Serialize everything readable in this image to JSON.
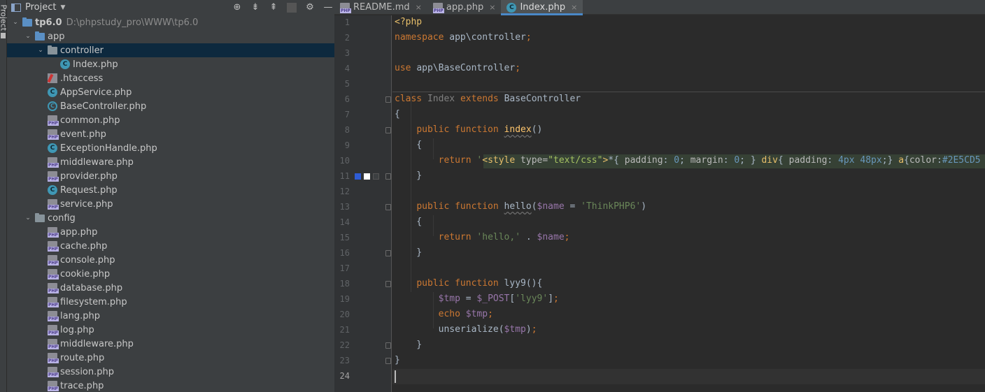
{
  "sidebar_strip": {
    "label": "Project"
  },
  "project_panel": {
    "title": "Project",
    "tools": [
      "⊕",
      "⇟",
      "⇞",
      "⚙",
      "—"
    ]
  },
  "tree": [
    {
      "label": "tp6.0",
      "path": "D:\\phpstudy_pro\\WWW\\tp6.0",
      "type": "folder-blue",
      "arrow": "⌄"
    },
    {
      "label": "app",
      "type": "folder-blue",
      "arrow": "⌄"
    },
    {
      "label": "controller",
      "type": "folder",
      "arrow": "⌄",
      "selected": true
    },
    {
      "label": "Index.php",
      "type": "cls"
    },
    {
      "label": ".htaccess",
      "type": "ht"
    },
    {
      "label": "AppService.php",
      "type": "cls"
    },
    {
      "label": "BaseController.php",
      "type": "acls"
    },
    {
      "label": "common.php",
      "type": "php"
    },
    {
      "label": "event.php",
      "type": "php"
    },
    {
      "label": "ExceptionHandle.php",
      "type": "cls"
    },
    {
      "label": "middleware.php",
      "type": "php"
    },
    {
      "label": "provider.php",
      "type": "php"
    },
    {
      "label": "Request.php",
      "type": "cls"
    },
    {
      "label": "service.php",
      "type": "php"
    },
    {
      "label": "config",
      "type": "folder",
      "arrow": "⌄"
    },
    {
      "label": "app.php",
      "type": "php"
    },
    {
      "label": "cache.php",
      "type": "php"
    },
    {
      "label": "console.php",
      "type": "php"
    },
    {
      "label": "cookie.php",
      "type": "php"
    },
    {
      "label": "database.php",
      "type": "php"
    },
    {
      "label": "filesystem.php",
      "type": "php"
    },
    {
      "label": "lang.php",
      "type": "php"
    },
    {
      "label": "log.php",
      "type": "php"
    },
    {
      "label": "middleware.php",
      "type": "php"
    },
    {
      "label": "route.php",
      "type": "php"
    },
    {
      "label": "session.php",
      "type": "php"
    },
    {
      "label": "trace.php",
      "type": "php"
    }
  ],
  "tabs": [
    {
      "label": "README.md",
      "icon": "md",
      "active": false
    },
    {
      "label": "app.php",
      "icon": "php",
      "active": false
    },
    {
      "label": "Index.php",
      "icon": "cls",
      "active": true
    }
  ],
  "editor": {
    "line_count": 24,
    "current_line": 24,
    "lines": [
      [
        [
          "tag",
          "<?php"
        ]
      ],
      [
        [
          "kw",
          "namespace "
        ],
        [
          "plain",
          "app\\controller"
        ],
        [
          "kw",
          ";"
        ]
      ],
      [],
      [
        [
          "kw",
          "use "
        ],
        [
          "plain",
          "app\\BaseController"
        ],
        [
          "kw",
          ";"
        ]
      ],
      [],
      [
        [
          "kw",
          "class "
        ],
        [
          "cls-n",
          "Index "
        ],
        [
          "kw",
          "extends "
        ],
        [
          "plain",
          "BaseController"
        ]
      ],
      [
        [
          "plain",
          "{"
        ]
      ],
      [
        [
          "plain",
          "    "
        ],
        [
          "kw",
          "public function "
        ],
        [
          "fn wavy",
          "index"
        ],
        [
          "plain",
          "()"
        ]
      ],
      [
        [
          "plain",
          "    {"
        ]
      ],
      [
        [
          "plain",
          "        "
        ],
        [
          "kw",
          "return "
        ],
        [
          "str",
          "'"
        ],
        [
          "tag",
          "<style "
        ],
        [
          "attr",
          "type="
        ],
        [
          "val",
          "\"text/css\""
        ],
        [
          "tag",
          ">"
        ],
        [
          "plain",
          "*{ "
        ],
        [
          "attr",
          "padding"
        ],
        [
          "plain",
          ": "
        ],
        [
          "num",
          "0"
        ],
        [
          "plain",
          "; "
        ],
        [
          "attr",
          "margin"
        ],
        [
          "plain",
          ": "
        ],
        [
          "num",
          "0"
        ],
        [
          "plain",
          "; } "
        ],
        [
          "tag",
          "div"
        ],
        [
          "plain",
          "{ "
        ],
        [
          "attr",
          "padding"
        ],
        [
          "plain",
          ": "
        ],
        [
          "num",
          "4px 48px"
        ],
        [
          "plain",
          ";} "
        ],
        [
          "tag",
          "a"
        ],
        [
          "plain",
          "{"
        ],
        [
          "attr",
          "color"
        ],
        [
          "plain",
          ":"
        ],
        [
          "num",
          "#2E5CD5"
        ]
      ],
      [
        [
          "plain",
          "    }"
        ]
      ],
      [],
      [
        [
          "plain",
          "    "
        ],
        [
          "kw",
          "public function "
        ],
        [
          "plain wavy",
          "hello"
        ],
        [
          "plain",
          "("
        ],
        [
          "var",
          "$name"
        ],
        [
          "plain",
          " = "
        ],
        [
          "str",
          "'ThinkPHP6'"
        ],
        [
          "plain",
          ")"
        ]
      ],
      [
        [
          "plain",
          "    {"
        ]
      ],
      [
        [
          "plain",
          "        "
        ],
        [
          "kw",
          "return "
        ],
        [
          "str",
          "'hello,' "
        ],
        [
          "plain",
          ". "
        ],
        [
          "var",
          "$name"
        ],
        [
          "kw",
          ";"
        ]
      ],
      [
        [
          "plain",
          "    }"
        ]
      ],
      [],
      [
        [
          "plain",
          "    "
        ],
        [
          "kw",
          "public function "
        ],
        [
          "plain",
          "lyy9(){"
        ]
      ],
      [
        [
          "plain",
          "        "
        ],
        [
          "var",
          "$tmp"
        ],
        [
          "plain",
          " = "
        ],
        [
          "var",
          "$_POST"
        ],
        [
          "plain",
          "["
        ],
        [
          "str",
          "'lyy9'"
        ],
        [
          "plain",
          "]"
        ],
        [
          "kw",
          ";"
        ]
      ],
      [
        [
          "plain",
          "        "
        ],
        [
          "kw",
          "echo "
        ],
        [
          "var",
          "$tmp"
        ],
        [
          "kw",
          ";"
        ]
      ],
      [
        [
          "plain",
          "        unserialize("
        ],
        [
          "var",
          "$tmp"
        ],
        [
          "plain",
          ")"
        ],
        [
          "kw",
          ";"
        ]
      ],
      [
        [
          "plain",
          "    }"
        ]
      ],
      [
        [
          "plain",
          "}"
        ]
      ],
      []
    ],
    "swatch_colors": [
      "#2e5cd5",
      "#ffffff",
      "#3c3f41"
    ]
  }
}
